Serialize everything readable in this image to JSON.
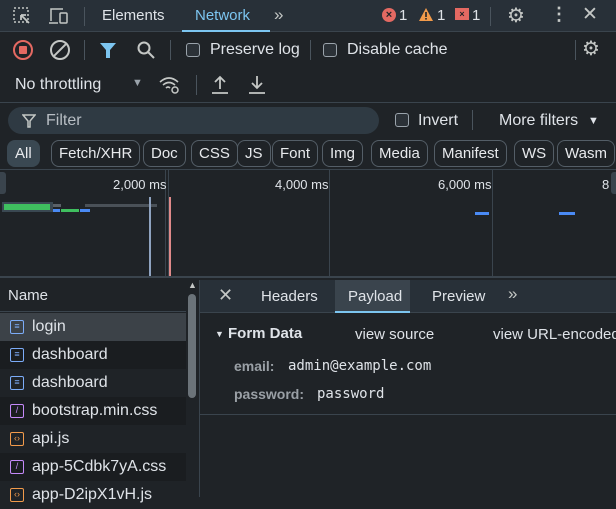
{
  "topbar": {
    "tabs": [
      "Elements",
      "Network"
    ],
    "active_tab": "Network",
    "errors": "1",
    "warnings": "1",
    "issues": "1"
  },
  "toolbar": {
    "preserve_log": "Preserve log",
    "disable_cache": "Disable cache",
    "throttling": "No throttling"
  },
  "filter": {
    "placeholder": "Filter",
    "invert": "Invert",
    "more_filters": "More filters"
  },
  "type_filters": [
    "All",
    "Fetch/XHR",
    "Doc",
    "CSS",
    "JS",
    "Font",
    "Img",
    "Media",
    "Manifest",
    "WS",
    "Wasm"
  ],
  "overview": {
    "ticks": [
      "2,000 ms",
      "4,000 ms",
      "6,000 ms",
      "8"
    ]
  },
  "requests": {
    "header": "Name",
    "items": [
      {
        "name": "login",
        "type": "doc"
      },
      {
        "name": "dashboard",
        "type": "doc"
      },
      {
        "name": "dashboard",
        "type": "doc"
      },
      {
        "name": "bootstrap.min.css",
        "type": "css"
      },
      {
        "name": "api.js",
        "type": "js"
      },
      {
        "name": "app-5Cdbk7yA.css",
        "type": "css"
      },
      {
        "name": "app-D2ipX1vH.js",
        "type": "js"
      }
    ]
  },
  "details": {
    "tabs": [
      "Headers",
      "Payload",
      "Preview"
    ],
    "active_tab": "Payload",
    "section": "Form Data",
    "view_source": "view source",
    "view_url_encoded": "view URL-encoded",
    "fields": [
      {
        "key": "email:",
        "value": "admin@example.com"
      },
      {
        "key": "password:",
        "value": "password"
      }
    ]
  },
  "colors": {
    "accent": "#7cacf8",
    "active_underline": "#7cc5f0",
    "error": "#e46962",
    "warning": "#f29b4b"
  }
}
